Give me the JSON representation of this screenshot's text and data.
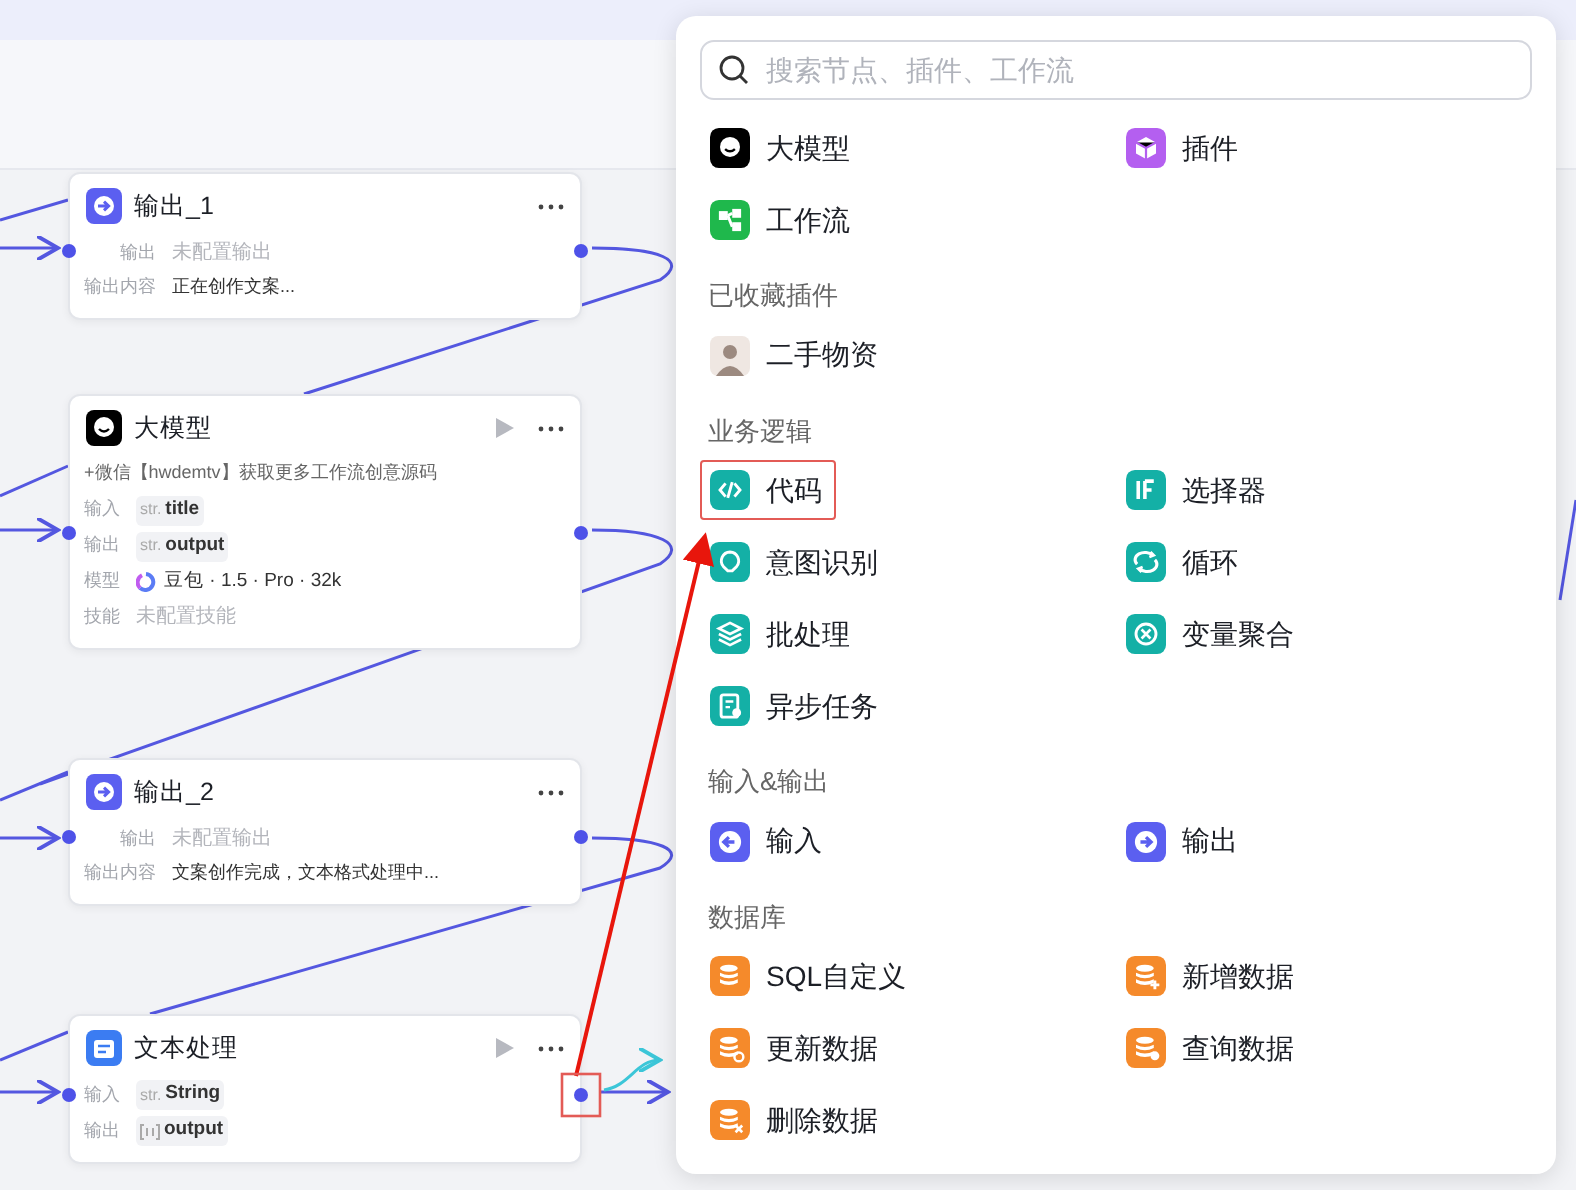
{
  "canvas": {
    "nodes": [
      {
        "kind": "output",
        "title": "输出_1",
        "run_icon": false,
        "rows": [
          {
            "kind": "placeholder",
            "label": "输出",
            "value": "未配置输出"
          },
          {
            "kind": "text",
            "label": "输出内容",
            "value": "正在创作文案..."
          }
        ]
      },
      {
        "kind": "llm",
        "title": "大模型",
        "run_icon": true,
        "rows": [
          {
            "kind": "note",
            "value": "+微信【hwdemtv】获取更多工作流创意源码"
          },
          {
            "kind": "tag",
            "label": "输入",
            "type_label": "str.",
            "value": "title"
          },
          {
            "kind": "tag",
            "label": "输出",
            "type_label": "str.",
            "value": "output"
          },
          {
            "kind": "model",
            "label": "模型",
            "value": "豆包 · 1.5 · Pro · 32k"
          },
          {
            "kind": "placeholder",
            "label": "技能",
            "value": "未配置技能"
          }
        ]
      },
      {
        "kind": "output",
        "title": "输出_2",
        "run_icon": false,
        "rows": [
          {
            "kind": "placeholder",
            "label": "输出",
            "value": "未配置输出"
          },
          {
            "kind": "text",
            "label": "输出内容",
            "value": "文案创作完成，文本格式处理中..."
          }
        ]
      },
      {
        "kind": "text",
        "title": "文本处理",
        "run_icon": true,
        "rows": [
          {
            "kind": "tag",
            "label": "输入",
            "type_label": "str.",
            "value": "String"
          },
          {
            "kind": "array_tag",
            "label": "输出",
            "value": "output"
          }
        ]
      }
    ]
  },
  "node_menu": {
    "search": {
      "placeholder": "搜索节点、插件、工作流"
    },
    "sections": [
      {
        "items": [
          {
            "label": "大模型",
            "color": "#000000",
            "highlighted": false
          },
          {
            "label": "插件",
            "color": "#b45ff0",
            "highlighted": false
          },
          {
            "label": "工作流",
            "color": "#1fb84c",
            "highlighted": false
          }
        ]
      },
      {
        "title": "已收藏插件",
        "items": [
          {
            "label": "二手物资",
            "kind": "avatar",
            "highlighted": false
          }
        ]
      },
      {
        "title": "业务逻辑",
        "items": [
          {
            "label": "代码",
            "color": "#14b0a6",
            "highlighted": true
          },
          {
            "label": "选择器",
            "color": "#14b0a6",
            "highlighted": false
          },
          {
            "label": "意图识别",
            "color": "#14b0a6",
            "highlighted": false
          },
          {
            "label": "循环",
            "color": "#14b0a6",
            "highlighted": false
          },
          {
            "label": "批处理",
            "color": "#14b0a6",
            "highlighted": false
          },
          {
            "label": "变量聚合",
            "color": "#14b0a6",
            "highlighted": false
          },
          {
            "label": "异步任务",
            "color": "#14b0a6",
            "highlighted": false
          }
        ]
      },
      {
        "title": "输入&输出",
        "items": [
          {
            "label": "输入",
            "color": "#5b5ff0",
            "highlighted": false
          },
          {
            "label": "输出",
            "color": "#5b5ff0",
            "highlighted": false
          }
        ]
      },
      {
        "title": "数据库",
        "items": [
          {
            "label": "SQL自定义",
            "color": "#f58a2b",
            "highlighted": false
          },
          {
            "label": "新增数据",
            "color": "#f58a2b",
            "highlighted": false
          },
          {
            "label": "更新数据",
            "color": "#f58a2b",
            "highlighted": false
          },
          {
            "label": "查询数据",
            "color": "#f58a2b",
            "highlighted": false
          },
          {
            "label": "删除数据",
            "color": "#f58a2b",
            "highlighted": false
          }
        ]
      }
    ]
  }
}
